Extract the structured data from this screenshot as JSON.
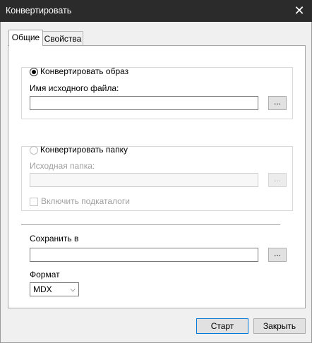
{
  "window": {
    "title": "Конвертировать",
    "close_glyph": "✕"
  },
  "tabs": [
    {
      "label": "Общие",
      "active": true
    },
    {
      "label": "Свойства",
      "active": false
    }
  ],
  "convert_image": {
    "radio_label": "Конвертировать образ",
    "checked": true,
    "source_label": "Имя исходного файла:",
    "source_value": "",
    "browse_label": "..."
  },
  "convert_folder": {
    "radio_label": "Конвертировать папку",
    "checked": false,
    "source_label": "Исходная папка:",
    "source_value": "",
    "browse_label": "...",
    "include_subdirs_label": "Включить подкаталоги",
    "include_subdirs_checked": false
  },
  "save": {
    "label": "Сохранить в",
    "value": "",
    "browse_label": "..."
  },
  "format": {
    "label": "Формат",
    "selected": "MDX"
  },
  "buttons": {
    "start": "Старт",
    "close": "Закрыть"
  }
}
